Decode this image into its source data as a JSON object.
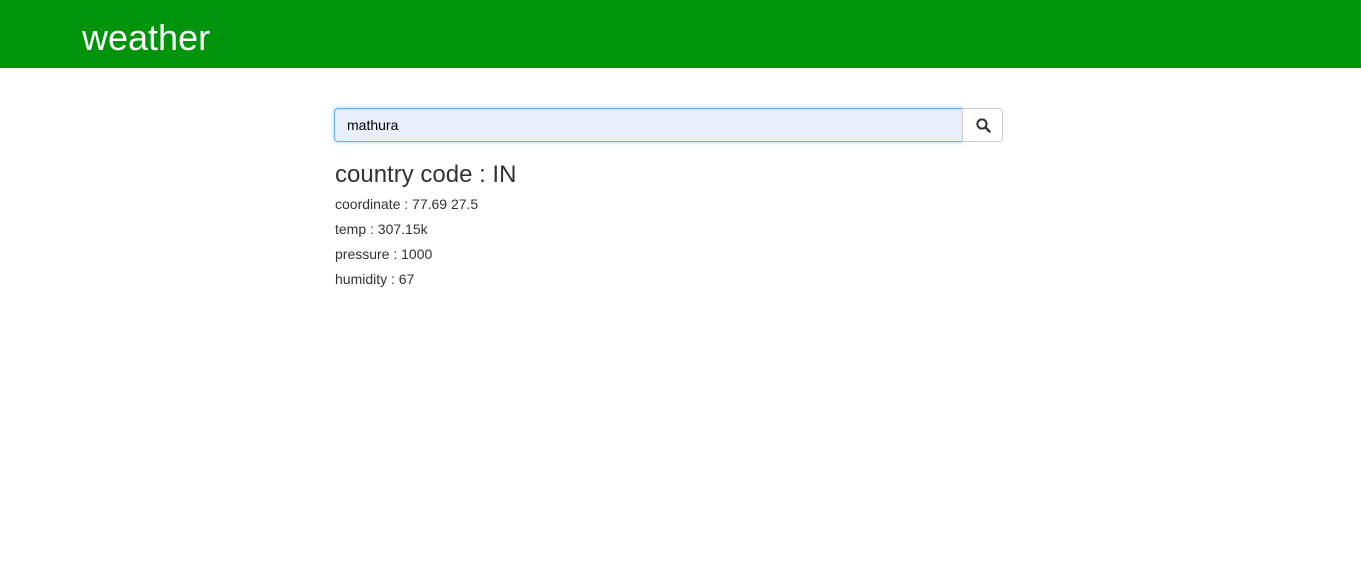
{
  "header": {
    "title": "weather"
  },
  "search": {
    "value": "mathura",
    "button_icon": "search-icon"
  },
  "result": {
    "country": "country code : IN",
    "coordinate": "coordinate : 77.69 27.5",
    "temp": "temp : 307.15k",
    "pressure": "pressure : 1000",
    "humidity": "humidity : 67"
  },
  "colors": {
    "header_bg": "#00930c",
    "header_text": "#ffffff",
    "input_bg": "#e8f0fe",
    "input_focus_border": "#66afe9",
    "text": "#333333"
  }
}
